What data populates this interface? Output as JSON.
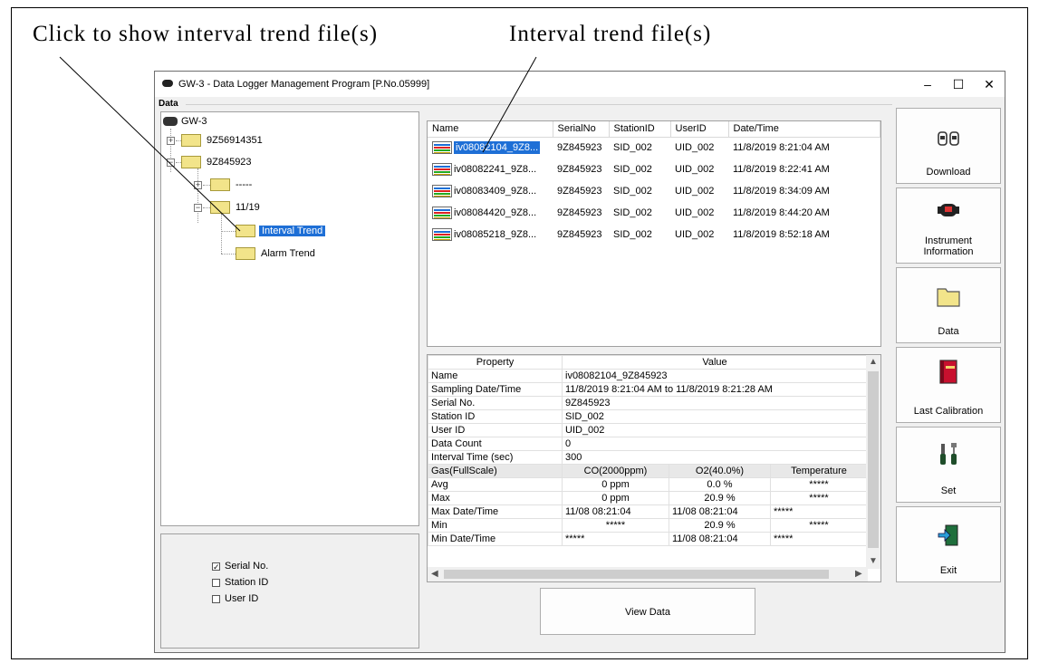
{
  "annotations": {
    "left": "Click to show interval trend file(s)",
    "right": "Interval trend file(s)"
  },
  "window": {
    "title": "GW-3 - Data Logger Management Program [P.No.05999]",
    "minimize": "–",
    "maximize": "☐",
    "close": "✕"
  },
  "group_label": "Data",
  "tree": {
    "root": "GW-3",
    "node1": "9Z56914351",
    "node2": "9Z845923",
    "node3": "-----",
    "node4": "11/19",
    "node5": "Interval Trend",
    "node6": "Alarm Trend"
  },
  "options": {
    "serial": "Serial No.",
    "station": "Station ID",
    "user": "User ID"
  },
  "file_list": {
    "columns": [
      "Name",
      "SerialNo",
      "StationID",
      "UserID",
      "Date/Time"
    ],
    "rows": [
      [
        "iv08082104_9Z8...",
        "9Z845923",
        "SID_002",
        "UID_002",
        "11/8/2019 8:21:04 AM"
      ],
      [
        "iv08082241_9Z8...",
        "9Z845923",
        "SID_002",
        "UID_002",
        "11/8/2019 8:22:41 AM"
      ],
      [
        "iv08083409_9Z8...",
        "9Z845923",
        "SID_002",
        "UID_002",
        "11/8/2019 8:34:09 AM"
      ],
      [
        "iv08084420_9Z8...",
        "9Z845923",
        "SID_002",
        "UID_002",
        "11/8/2019 8:44:20 AM"
      ],
      [
        "iv08085218_9Z8...",
        "9Z845923",
        "SID_002",
        "UID_002",
        "11/8/2019 8:52:18 AM"
      ]
    ]
  },
  "properties": {
    "header": [
      "Property",
      "Value"
    ],
    "name": [
      "Name",
      "iv08082104_9Z845923"
    ],
    "sampling": [
      "Sampling Date/Time",
      "11/8/2019 8:21:04 AM to 11/8/2019 8:21:28 AM"
    ],
    "serial": [
      "Serial No.",
      "9Z845923"
    ],
    "station": [
      "Station ID",
      "SID_002"
    ],
    "user": [
      "User ID",
      "UID_002"
    ],
    "count": [
      "Data Count",
      "0"
    ],
    "interval": [
      "Interval Time (sec)",
      "300"
    ],
    "gas": [
      "Gas(FullScale)",
      "CO(2000ppm)",
      "O2(40.0%)",
      "Temperature"
    ],
    "avg": [
      "Avg",
      "0 ppm",
      "0.0 %",
      "*****"
    ],
    "max": [
      "Max",
      "0 ppm",
      "20.9 %",
      "*****"
    ],
    "maxdt": [
      "Max Date/Time",
      "11/08 08:21:04",
      "11/08 08:21:04",
      "*****"
    ],
    "min": [
      "Min",
      "*****",
      "20.9 %",
      "*****"
    ],
    "mindt": [
      "Min Date/Time",
      "*****",
      "11/08 08:21:04",
      "*****"
    ]
  },
  "buttons": {
    "view_data": "View Data",
    "download": "Download",
    "instrument_line1": "Instrument",
    "instrument_line2": "Information",
    "data": "Data",
    "last_calibration": "Last Calibration",
    "set": "Set",
    "exit": "Exit"
  },
  "checkmark": "✓"
}
